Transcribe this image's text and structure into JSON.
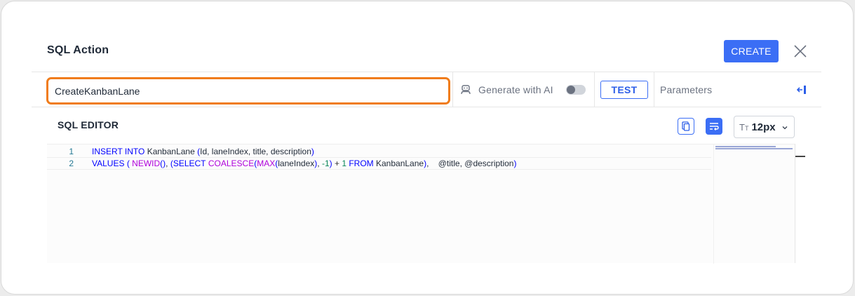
{
  "dialog": {
    "title": "SQL Action",
    "create_label": "CREATE",
    "close_icon": "close-icon"
  },
  "toolbar": {
    "name_value": "CreateKanbanLane",
    "ai_icon": "robot-icon",
    "generate_ai_label": "Generate with AI",
    "ai_toggle_on": false,
    "test_label": "TEST",
    "parameters_label": "Parameters",
    "collapse_icon": "collapse-panel-icon"
  },
  "editor": {
    "label": "SQL EDITOR",
    "copy_icon": "copy-icon",
    "wrap_icon": "word-wrap-icon",
    "font_size_icon": "text-size-icon",
    "font_size_value": "12px",
    "lines": [
      {
        "number": "1",
        "tokens": [
          {
            "t": "INSERT INTO",
            "c": "kw"
          },
          {
            "t": " KanbanLane ",
            "c": "tx"
          },
          {
            "t": "(",
            "c": "kw"
          },
          {
            "t": "Id, laneIndex, title, description",
            "c": "tx"
          },
          {
            "t": ")",
            "c": "kw"
          }
        ]
      },
      {
        "number": "2",
        "tokens": [
          {
            "t": "VALUES",
            "c": "kw"
          },
          {
            "t": " ",
            "c": "tx"
          },
          {
            "t": "(",
            "c": "kw"
          },
          {
            "t": " ",
            "c": "tx"
          },
          {
            "t": "NEWID",
            "c": "fn"
          },
          {
            "t": "()",
            "c": "kw"
          },
          {
            "t": ", ",
            "c": "tx"
          },
          {
            "t": "(SELECT",
            "c": "kw"
          },
          {
            "t": " ",
            "c": "tx"
          },
          {
            "t": "COALESCE",
            "c": "fn"
          },
          {
            "t": "(",
            "c": "kw"
          },
          {
            "t": "MAX",
            "c": "fn"
          },
          {
            "t": "(",
            "c": "kw"
          },
          {
            "t": "laneIndex",
            "c": "tx"
          },
          {
            "t": ")",
            "c": "kw"
          },
          {
            "t": ", ",
            "c": "tx"
          },
          {
            "t": "-1",
            "c": "num"
          },
          {
            "t": ")",
            "c": "kw"
          },
          {
            "t": " + ",
            "c": "op"
          },
          {
            "t": "1",
            "c": "num"
          },
          {
            "t": " FROM",
            "c": "kw"
          },
          {
            "t": " KanbanLane",
            "c": "tx"
          },
          {
            "t": ")",
            "c": "kw"
          },
          {
            "t": ",    @title, @description",
            "c": "tx"
          },
          {
            "t": ")",
            "c": "kw"
          }
        ]
      }
    ]
  }
}
